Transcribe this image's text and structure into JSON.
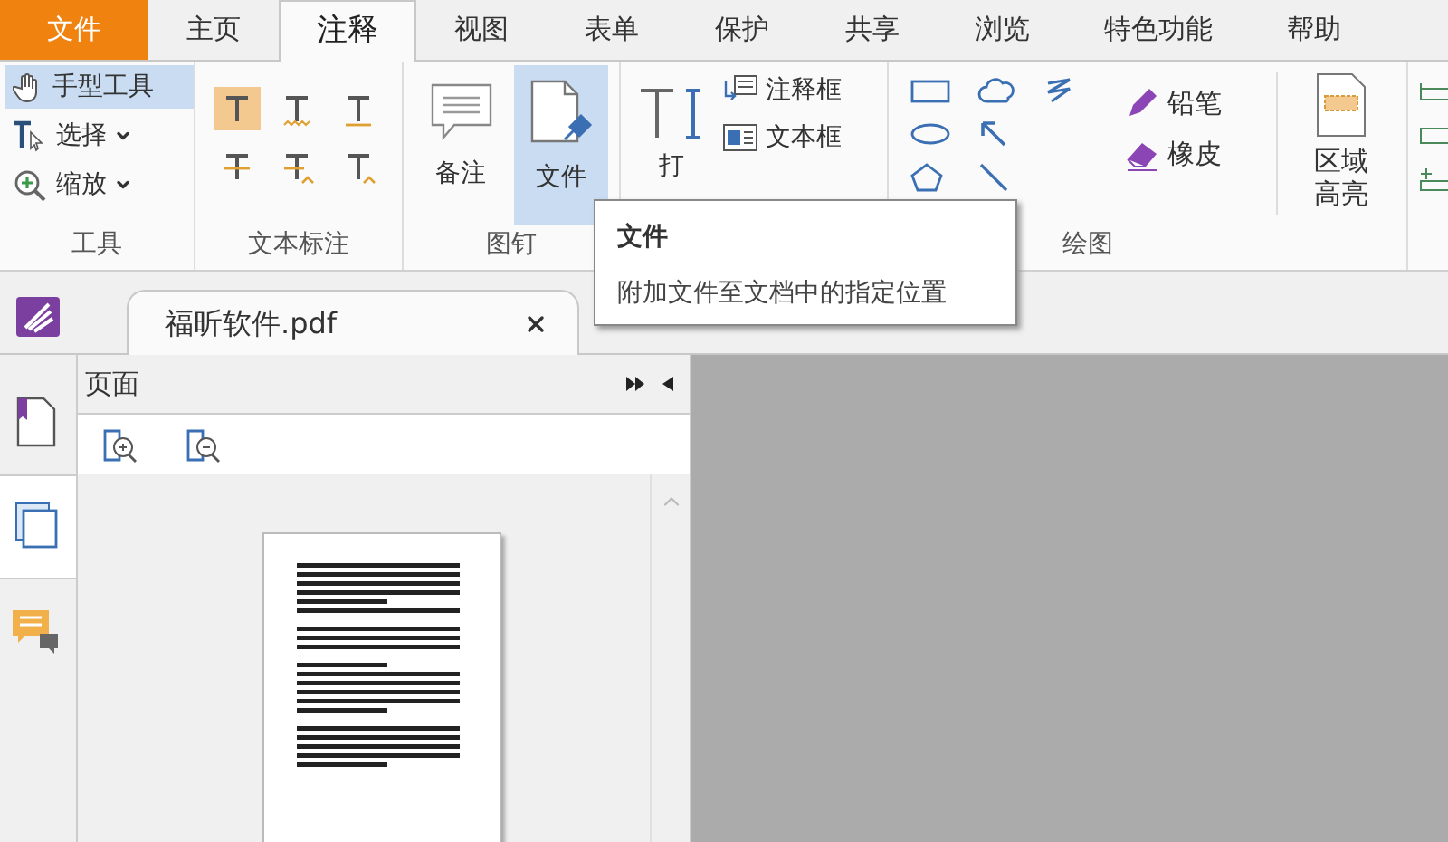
{
  "menu_tabs": [
    {
      "label": "文件",
      "kind": "file"
    },
    {
      "label": "主页",
      "kind": "tab",
      "selected": false
    },
    {
      "label": "注释",
      "kind": "tab",
      "selected": true
    },
    {
      "label": "视图",
      "kind": "tab",
      "selected": false
    },
    {
      "label": "表单",
      "kind": "tab",
      "selected": false
    },
    {
      "label": "保护",
      "kind": "tab",
      "selected": false
    },
    {
      "label": "共享",
      "kind": "tab",
      "selected": false
    },
    {
      "label": "浏览",
      "kind": "tab",
      "selected": false
    },
    {
      "label": "特色功能",
      "kind": "tab",
      "selected": false
    },
    {
      "label": "帮助",
      "kind": "tab",
      "selected": false
    }
  ],
  "tools_group": {
    "label": "工具",
    "items": [
      {
        "label": "手型工具",
        "kind": "hand",
        "active": true,
        "dropdown": false
      },
      {
        "label": "选择",
        "kind": "select",
        "active": false,
        "dropdown": true
      },
      {
        "label": "缩放",
        "kind": "zoom",
        "active": false,
        "dropdown": true
      }
    ]
  },
  "text_markup_group": {
    "label": "文本标注",
    "tools": [
      {
        "kind": "highlight",
        "active": true
      },
      {
        "kind": "squiggly",
        "active": false
      },
      {
        "kind": "underline",
        "active": false
      },
      {
        "kind": "strikeout",
        "active": false
      },
      {
        "kind": "replace",
        "active": false
      },
      {
        "kind": "insert",
        "active": false
      }
    ]
  },
  "pin_group": {
    "label": "图钉",
    "items": [
      {
        "label": "备注",
        "kind": "note",
        "active": false
      },
      {
        "label": "文件",
        "kind": "file",
        "active": true
      }
    ]
  },
  "typewriter_group": {
    "label": "打",
    "items": [
      {
        "label": "注释框",
        "kind": "callout"
      },
      {
        "label": "文本框",
        "kind": "textbox"
      }
    ]
  },
  "drawing_group": {
    "label": "绘图",
    "items": [
      {
        "label": "铅笔",
        "kind": "pencil"
      },
      {
        "label": "橡皮",
        "kind": "eraser"
      }
    ],
    "area_highlight": "区域高亮"
  },
  "tooltip": {
    "title": "文件",
    "text": "附加文件至文档中的指定位置"
  },
  "document_tabs": [
    {
      "label": "福昕软件.pdf",
      "selected": true
    }
  ],
  "panel": {
    "title": "页面",
    "side_tabs": [
      {
        "kind": "bookmarks",
        "selected": false
      },
      {
        "kind": "pages",
        "selected": true
      },
      {
        "kind": "comments",
        "selected": false
      }
    ]
  }
}
